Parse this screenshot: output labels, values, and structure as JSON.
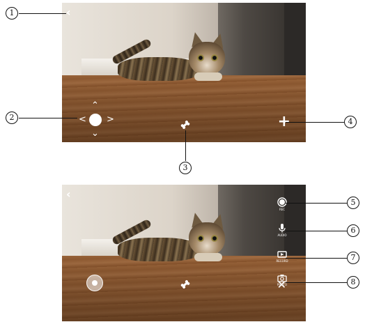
{
  "callouts": [
    "1",
    "2",
    "3",
    "4",
    "5",
    "6",
    "7",
    "8"
  ],
  "top_screen": {
    "back_icon": "‹",
    "dpad_arrows": {
      "up": "^",
      "left": "<",
      "right": ">",
      "down": "v"
    },
    "treat_icon": "bone-icon",
    "add_icon": "+"
  },
  "bottom_screen": {
    "back_icon": "‹",
    "joystick_icon": "joystick-icon",
    "treat_icon": "bone-icon",
    "close_icon": "✕",
    "side_buttons": [
      {
        "icon": "record-icon",
        "label": "REC"
      },
      {
        "icon": "microphone-icon",
        "label": "AUDIO"
      },
      {
        "icon": "video-icon",
        "label": "RECORD"
      },
      {
        "icon": "camera-icon",
        "label": "PHOTO"
      }
    ]
  },
  "colors": {
    "overlay": "#ffffff",
    "callout": "#111111"
  }
}
